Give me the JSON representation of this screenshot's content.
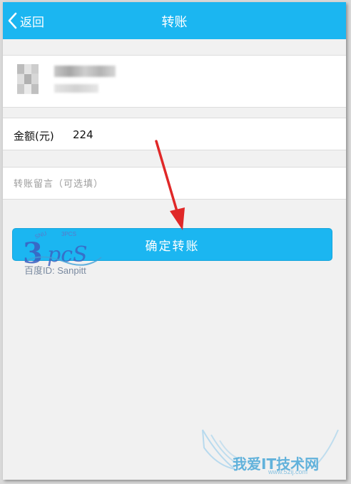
{
  "header": {
    "back_label": "返回",
    "title": "转账"
  },
  "amount": {
    "label": "金额(元)",
    "value": "224"
  },
  "remark": {
    "placeholder": "转账留言（可选填）"
  },
  "confirm_button": {
    "label": "确定转账"
  },
  "watermark": {
    "caption": "百度ID: Sanpitt",
    "site_text": "我爱IT技术网",
    "site_url": "www.52ij.com"
  },
  "colors": {
    "accent": "#1bb6f1",
    "background": "#f1f1f1",
    "annotation_arrow": "#e02828"
  }
}
